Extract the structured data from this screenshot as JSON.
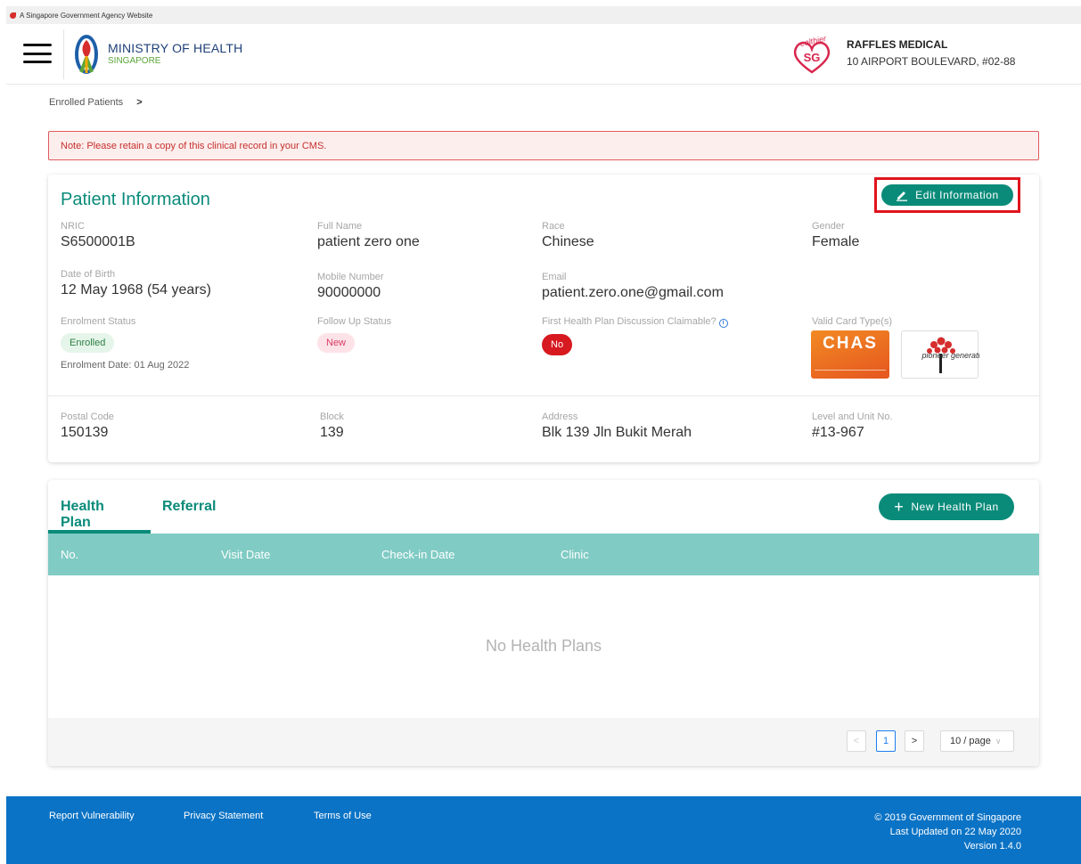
{
  "gov_bar": {
    "text": "A Singapore Government Agency Website"
  },
  "header": {
    "ministry_name": "MINISTRY OF HEALTH",
    "ministry_country": "SINGAPORE",
    "healthier_logo_text": "Healthier SG",
    "clinic_name": "RAFFLES MEDICAL",
    "clinic_address": "10 AIRPORT BOULEVARD, #02-88"
  },
  "breadcrumb": {
    "item": "Enrolled Patients",
    "separator": ">"
  },
  "note": "Note: Please retain a copy of this clinical record in your CMS.",
  "patient_info": {
    "title": "Patient Information",
    "edit_label": "Edit Information",
    "nric": {
      "label": "NRIC",
      "value": "S6500001B"
    },
    "full_name": {
      "label": "Full Name",
      "value": "patient zero one"
    },
    "race": {
      "label": "Race",
      "value": "Chinese"
    },
    "gender": {
      "label": "Gender",
      "value": "Female"
    },
    "dob": {
      "label": "Date of Birth",
      "value": "12 May 1968 (54 years)"
    },
    "mobile": {
      "label": "Mobile Number",
      "value": "90000000"
    },
    "email": {
      "label": "Email",
      "value": "patient.zero.one@gmail.com"
    },
    "enrolment_status": {
      "label": "Enrolment Status",
      "value": "Enrolled",
      "date_text": "Enrolment Date: 01 Aug 2022"
    },
    "follow_up_status": {
      "label": "Follow Up Status",
      "value": "New"
    },
    "fhpd_claimable": {
      "label": "First Health Plan Discussion Claimable?",
      "value": "No"
    },
    "valid_cards": {
      "label": "Valid Card Type(s)",
      "chas": "CHAS",
      "pioneer": "pioneer generation"
    },
    "postal_code": {
      "label": "Postal Code",
      "value": "150139"
    },
    "block": {
      "label": "Block",
      "value": "139"
    },
    "address": {
      "label": "Address",
      "value": "Blk 139 Jln Bukit Merah"
    },
    "unit": {
      "label": "Level and Unit No.",
      "value": "#13-967"
    }
  },
  "plans": {
    "tabs": [
      {
        "label": "Health Plan",
        "active": true
      },
      {
        "label": "Referral",
        "active": false
      }
    ],
    "new_label": "New Health Plan",
    "columns": [
      "No.",
      "Visit Date",
      "Check-in Date",
      "Clinic"
    ],
    "empty_text": "No Health Plans",
    "pagination": {
      "prev": "<",
      "current": "1",
      "next": ">",
      "page_size": "10 / page"
    }
  },
  "footer": {
    "links": [
      "Report Vulnerability",
      "Privacy Statement",
      "Terms of Use"
    ],
    "copyright": "© 2019 Government of Singapore",
    "last_updated": "Last Updated on 22 May 2020",
    "version": "Version 1.4.0"
  },
  "colors": {
    "primary": "#0a8b7a",
    "table_header": "#80cbc4",
    "footer": "#0b73c5",
    "alert": "#d71920"
  }
}
